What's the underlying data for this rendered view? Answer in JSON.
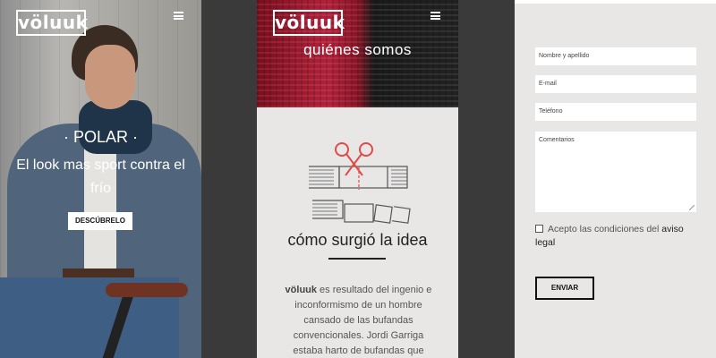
{
  "brand": {
    "logo_text": "völuuk"
  },
  "icons": {
    "menu": "hamburger-menu-icon",
    "scissors": "scissors-icon",
    "check": "checkbox-icon"
  },
  "screen1": {
    "title": "· POLAR ·",
    "subtitle": "El look mas sport contra el frío",
    "cta_label": "DESCÚBRELO"
  },
  "screen2": {
    "banner_title": "quiénes somos",
    "section_title": "cómo surgió la idea",
    "body_brand": "völuuk",
    "body_text": " es resultado del ingenio e inconformismo de un hombre cansado de las bufandas convencionales. Jordi Garriga estaba harto de bufandas que"
  },
  "screen3": {
    "form": {
      "name_placeholder": "Nombre y apellido",
      "email_placeholder": "E-mail",
      "phone_placeholder": "Teléfono",
      "comments_placeholder": "Comentarios",
      "consent_text": "Acepto las condiciones del ",
      "consent_link": "aviso legal",
      "submit_label": "ENVIAR"
    }
  },
  "colors": {
    "accent_red": "#e24a4a",
    "dark": "#111111",
    "panel_bg": "#e8e7e6",
    "page_bg": "#3a3a3a"
  }
}
